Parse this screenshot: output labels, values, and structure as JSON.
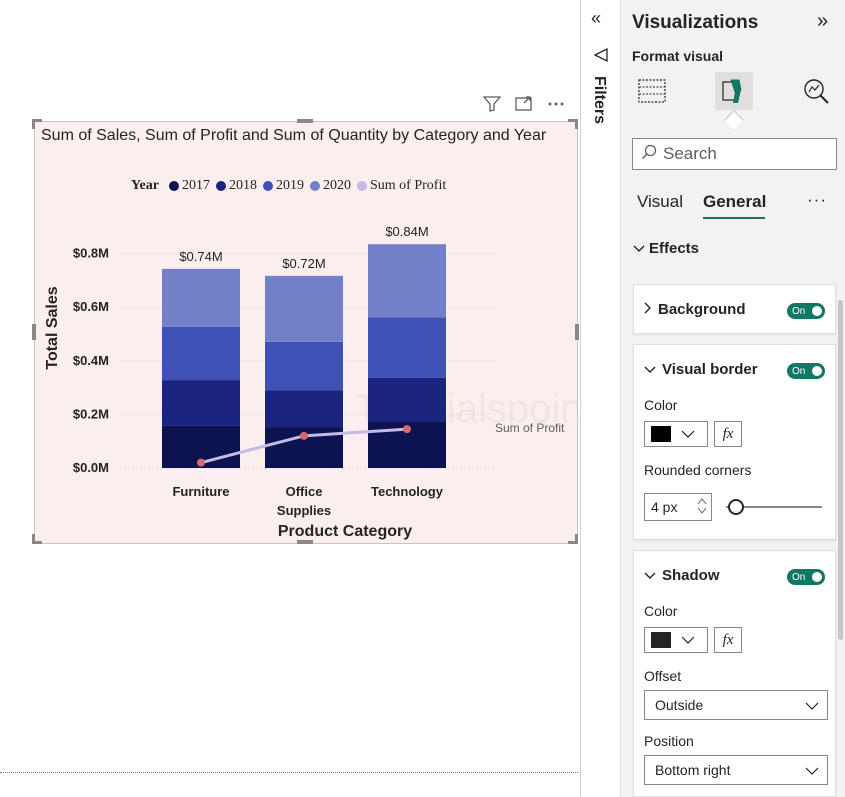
{
  "visual": {
    "title": "Sum of Sales, Sum of Profit and Sum of Quantity by Category and Year",
    "legend": {
      "title": "Year",
      "items": [
        {
          "label": "2017",
          "color": "#0d1250"
        },
        {
          "label": "2018",
          "color": "#1a237e"
        },
        {
          "label": "2019",
          "color": "#3f51b5"
        },
        {
          "label": "2020",
          "color": "#7280c9"
        },
        {
          "label": "Sum of Profit",
          "color": "#c5b9e6"
        }
      ]
    },
    "watermark": "Tutorialspoint"
  },
  "chart_data": {
    "type": "bar",
    "stacked": true,
    "categories": [
      "Furniture",
      "Office Supplies",
      "Technology"
    ],
    "category_labels": [
      [
        "Furniture"
      ],
      [
        "Office",
        "Supplies"
      ],
      [
        "Technology"
      ]
    ],
    "series": [
      {
        "name": "2017",
        "values": [
          0.157,
          0.151,
          0.175
        ],
        "color": "#0d1250"
      },
      {
        "name": "2018",
        "values": [
          0.171,
          0.138,
          0.161
        ],
        "color": "#1a237e"
      },
      {
        "name": "2019",
        "values": [
          0.199,
          0.182,
          0.226
        ],
        "color": "#3f51b5"
      },
      {
        "name": "2020",
        "values": [
          0.216,
          0.246,
          0.273
        ],
        "color": "#7280c9"
      }
    ],
    "totals_labels": [
      "$0.74M",
      "$0.72M",
      "$0.84M"
    ],
    "line_series": {
      "name": "Sum of Profit",
      "label": "Sum of Profit",
      "values": [
        0.02,
        0.12,
        0.145
      ],
      "color": "#c5b9e6",
      "marker_color": "#d46a6a"
    },
    "y_ticks": [
      "$0.0M",
      "$0.2M",
      "$0.4M",
      "$0.6M",
      "$0.8M"
    ],
    "y_tick_values": [
      0,
      0.2,
      0.4,
      0.6,
      0.8
    ],
    "ylim": [
      0,
      0.84
    ],
    "xlabel": "Product Category",
    "ylabel": "Total Sales",
    "grid": true
  },
  "filters": {
    "label": "Filters",
    "collapse_icon": "double-chevron-left-icon"
  },
  "viz_pane": {
    "title": "Visualizations",
    "expand_icon": "double-chevron-right-icon",
    "format_visual_label": "Format visual",
    "search_placeholder": "Search",
    "tabs": [
      {
        "label": "Visual"
      },
      {
        "label": "General"
      }
    ],
    "active_tab": "General",
    "more_label": "···",
    "effects_label": "Effects",
    "background": {
      "label": "Background",
      "toggle": "On"
    },
    "visual_border": {
      "label": "Visual border",
      "toggle": "On",
      "color_label": "Color",
      "color": "#000000",
      "fx": "fx",
      "rounded_label": "Rounded corners",
      "rounded_value": "4 px"
    },
    "shadow": {
      "label": "Shadow",
      "toggle": "On",
      "color_label": "Color",
      "color": "#252423",
      "fx": "fx",
      "offset_label": "Offset",
      "offset_value": "Outside",
      "position_label": "Position",
      "position_value": "Bottom right"
    },
    "accent_color": "#117865"
  }
}
